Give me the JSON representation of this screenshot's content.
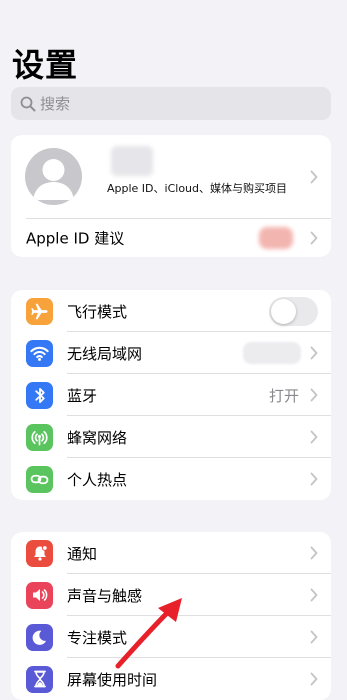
{
  "header": {
    "title": "设置"
  },
  "search": {
    "placeholder": "搜索"
  },
  "profile": {
    "subtitle": "Apple ID、iCloud、媒体与购买项目",
    "suggestion_label": "Apple ID 建议"
  },
  "connectivity": {
    "items": [
      {
        "label": "飞行模式",
        "icon": "airplane-icon",
        "color": "#f7a23b"
      },
      {
        "label": "无线局域网",
        "icon": "wifi-icon",
        "color": "#3478f6"
      },
      {
        "label": "蓝牙",
        "icon": "bluetooth-icon",
        "color": "#3478f6",
        "value": "打开"
      },
      {
        "label": "蜂窝网络",
        "icon": "cellular-icon",
        "color": "#5ac55e"
      },
      {
        "label": "个人热点",
        "icon": "hotspot-icon",
        "color": "#5ac55e"
      }
    ]
  },
  "notifications": {
    "items": [
      {
        "label": "通知",
        "icon": "bell-icon",
        "color": "#ea4d3d"
      },
      {
        "label": "声音与触感",
        "icon": "speaker-icon",
        "color": "#e9445a"
      },
      {
        "label": "专注模式",
        "icon": "moon-icon",
        "color": "#5b5ad6"
      },
      {
        "label": "屏幕使用时间",
        "icon": "hourglass-icon",
        "color": "#5b5ad6"
      }
    ]
  },
  "colors": {
    "annotation_arrow": "#e8202a"
  }
}
